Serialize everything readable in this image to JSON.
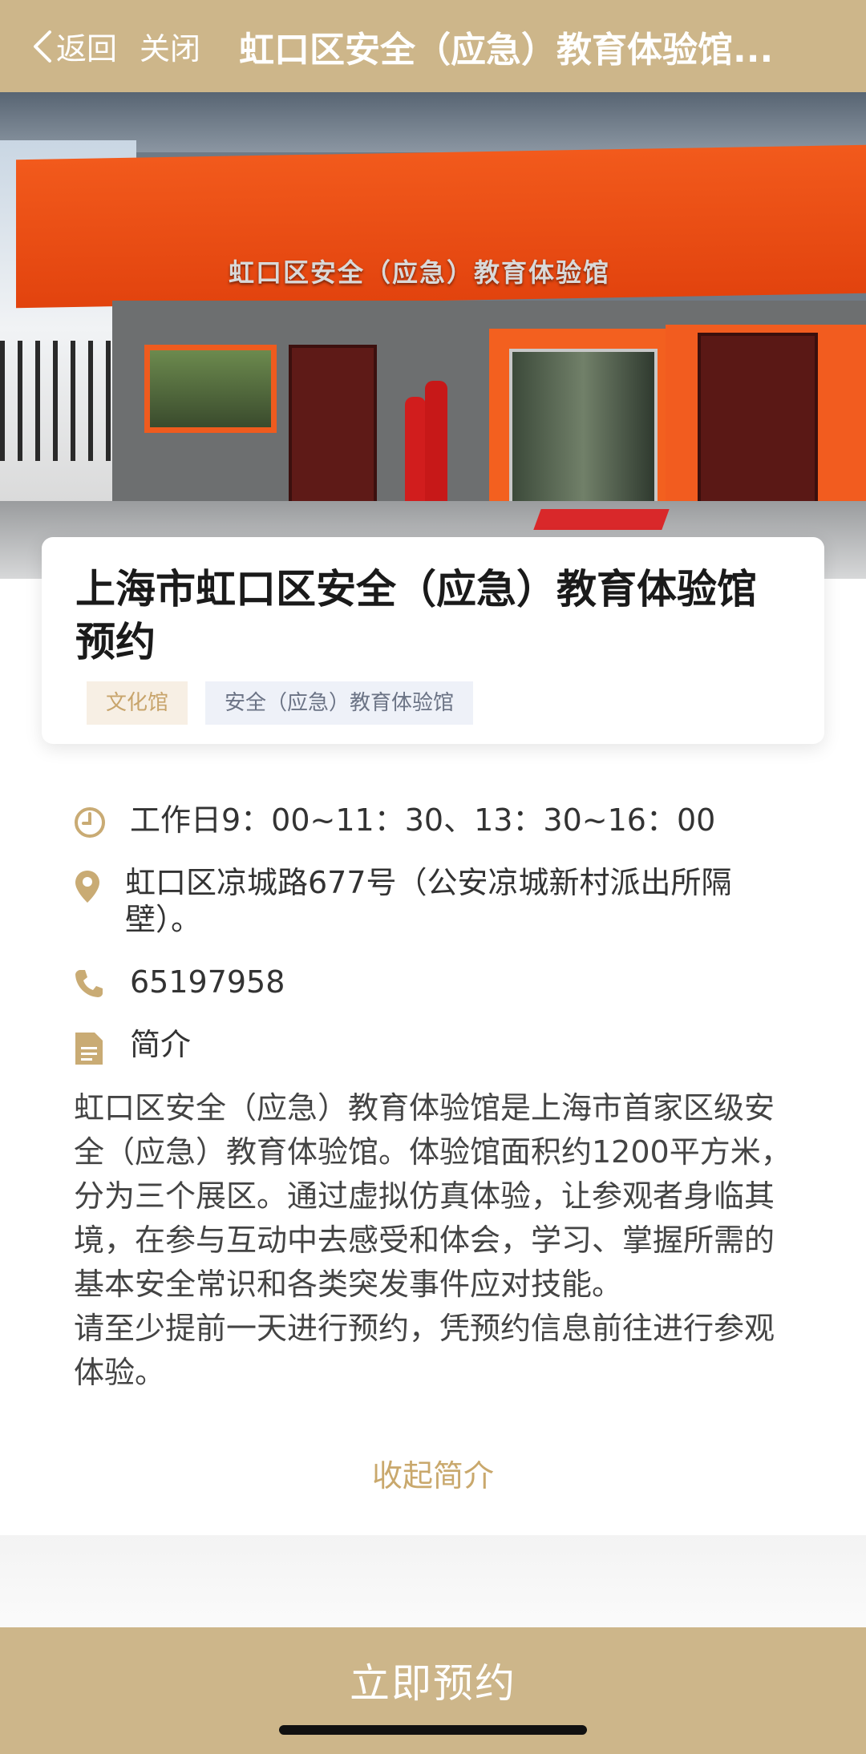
{
  "nav": {
    "back_label": "返回",
    "close_label": "关闭",
    "title": "虹口区安全（应急）教育体验馆..."
  },
  "hero": {
    "sign_text": "虹口区安全（应急）教育体验馆"
  },
  "card": {
    "title": "上海市虹口区安全（应急）教育体验馆预约",
    "tags": [
      "文化馆",
      "安全（应急）教育体验馆"
    ]
  },
  "info": {
    "hours": "工作日9：00~11：30、13：30~16：00",
    "address": "虹口区凉城路677号（公安凉城新村派出所隔壁）。",
    "phone": "65197958",
    "intro_label": "简介"
  },
  "description": {
    "p1": "虹口区安全（应急）教育体验馆是上海市首家区级安全（应急）教育体验馆。体验馆面积约1200平方米，分为三个展区。通过虚拟仿真体验，让参观者身临其境，在参与互动中去感受和体会，学习、掌握所需的基本安全常识和各类突发事件应对技能。",
    "p2": "请至少提前一天进行预约，凭预约信息前往进行参观体验。",
    "collapse_label": "收起简介"
  },
  "actions": {
    "book_label": "立即预约"
  },
  "colors": {
    "accent": "#cdb68a",
    "link": "#c9a86c",
    "icon": "#c9ab74"
  }
}
